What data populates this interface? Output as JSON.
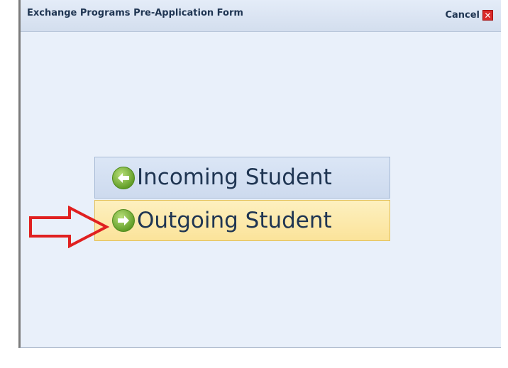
{
  "dialog": {
    "title": "Exchange Programs Pre-Application Form",
    "cancel_label": "Cancel"
  },
  "options": {
    "incoming": {
      "label": "Incoming Student",
      "icon": "arrow-left-circle-icon"
    },
    "outgoing": {
      "label": "Outgoing Student",
      "icon": "arrow-right-circle-icon"
    }
  },
  "annotation": {
    "icon": "red-arrow-icon",
    "color": "#e02020"
  },
  "colors": {
    "title_text": "#1f3552",
    "incoming_bg": "#d3dff1",
    "outgoing_bg": "#fbe7a6",
    "icon_green": "#7cb73a"
  }
}
